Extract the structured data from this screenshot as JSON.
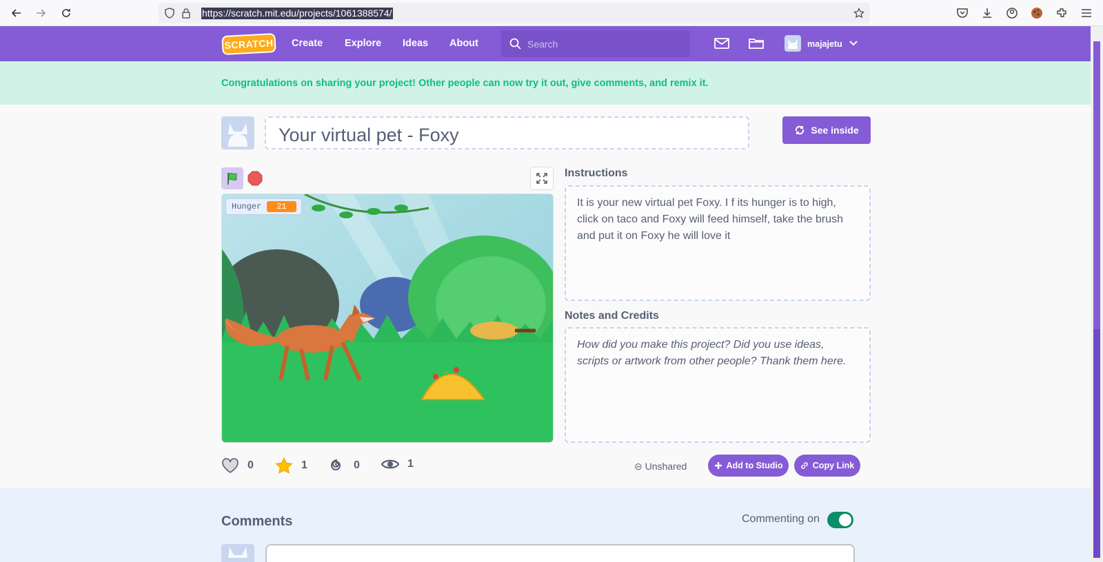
{
  "browser": {
    "url": "https://scratch.mit.edu/projects/1061388574/"
  },
  "header": {
    "logo_text": "SCRATCH",
    "nav": [
      "Create",
      "Explore",
      "Ideas",
      "About"
    ],
    "search_placeholder": "Search",
    "username": "majajetu"
  },
  "banner": {
    "text": "Congratulations on sharing your project! Other people can now try it out, give comments, and remix it."
  },
  "project": {
    "title": "Your virtual pet - Foxy",
    "see_inside_label": "See inside",
    "variable": {
      "name": "Hunger",
      "value": "21"
    },
    "instructions_label": "Instructions",
    "instructions_text": "It is your new virtual pet Foxy. I f its hunger is to high, click on taco and Foxy will feed himself, take the brush and put it on Foxy he will love it",
    "notes_label": "Notes and Credits",
    "notes_text": "How did you make this project? Did you use ideas, scripts or artwork from other people? Thank them here.",
    "stats": {
      "loves": "0",
      "favorites": "1",
      "remixes": "0",
      "views": "1"
    },
    "share_status": "Unshared",
    "add_to_studio_label": "Add to Studio",
    "copy_link_label": "Copy Link"
  },
  "comments": {
    "title": "Comments",
    "commenting_label": "Commenting on"
  },
  "colors": {
    "brand": "#855cd6",
    "banner_bg": "#d1f2e6",
    "banner_text": "#0fbd8c",
    "toggle_on": "#0b8e69",
    "variable_orange": "#ff8c1a"
  }
}
